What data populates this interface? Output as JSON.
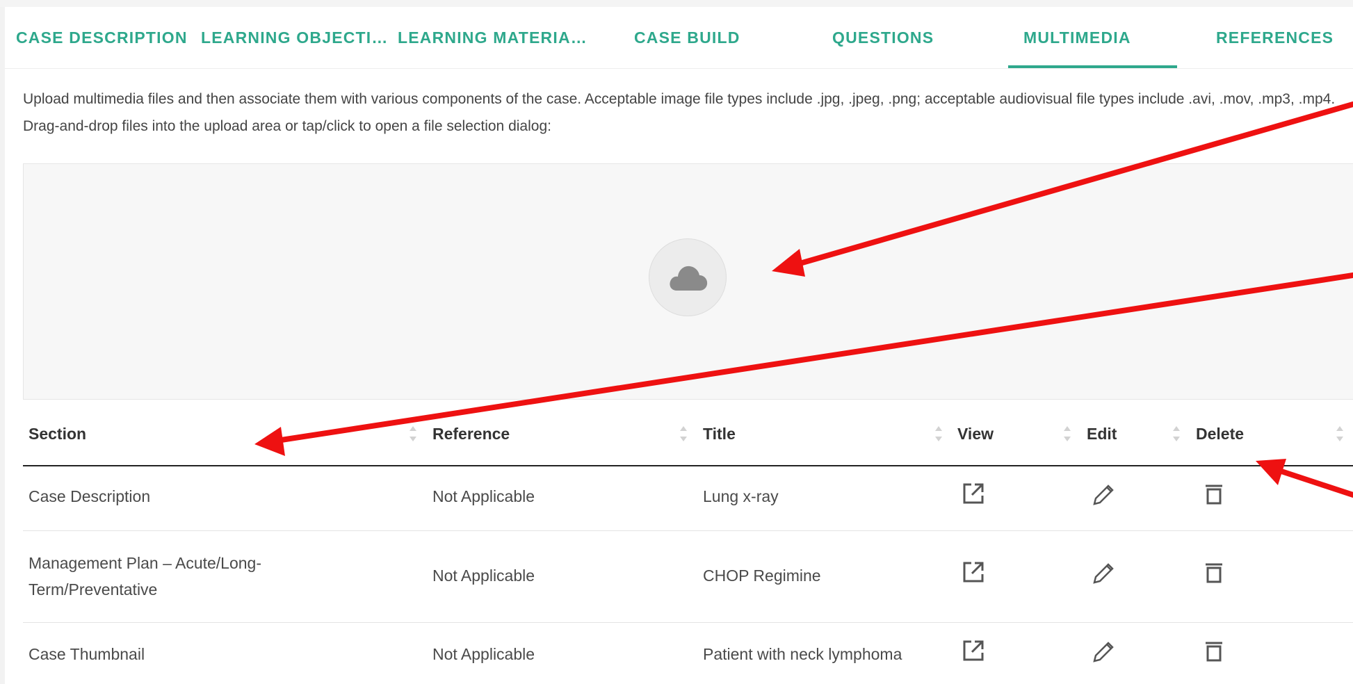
{
  "tabs": [
    {
      "label": "CASE DESCRIPTION"
    },
    {
      "label": "LEARNING OBJECTI…"
    },
    {
      "label": "LEARNING MATERIA…"
    },
    {
      "label": "CASE BUILD"
    },
    {
      "label": "QUESTIONS"
    },
    {
      "label": "MULTIMEDIA"
    },
    {
      "label": "REFERENCES"
    }
  ],
  "active_tab": "MULTIMEDIA",
  "description": "Upload multimedia files and then associate them with various components of the case. Acceptable image file types include .jpg, .jpeg, .png; acceptable audiovisual file types include .avi, .mov, .mp3, .mp4. Drag-and-drop files into the upload area or tap/click to open a file selection dialog:",
  "upload": {
    "icon": "cloud-icon"
  },
  "table": {
    "columns": [
      "Section",
      "Reference",
      "Title",
      "View",
      "Edit",
      "Delete"
    ],
    "rows": [
      {
        "section": "Case Description",
        "reference": "Not Applicable",
        "title": "Lung x-ray"
      },
      {
        "section": "Management Plan – Acute/Long-Term/Preventative",
        "reference": "Not Applicable",
        "title": "CHOP Regimine"
      },
      {
        "section": "Case Thumbnail",
        "reference": "Not Applicable",
        "title": "Patient with neck lymphoma"
      }
    ],
    "icons": {
      "view": "open-external-icon",
      "edit": "pencil-icon",
      "delete": "trash-icon",
      "sort": "sort-icon"
    }
  },
  "colors": {
    "accent": "#2ea88c",
    "annotation_arrow": "#ee1111"
  }
}
